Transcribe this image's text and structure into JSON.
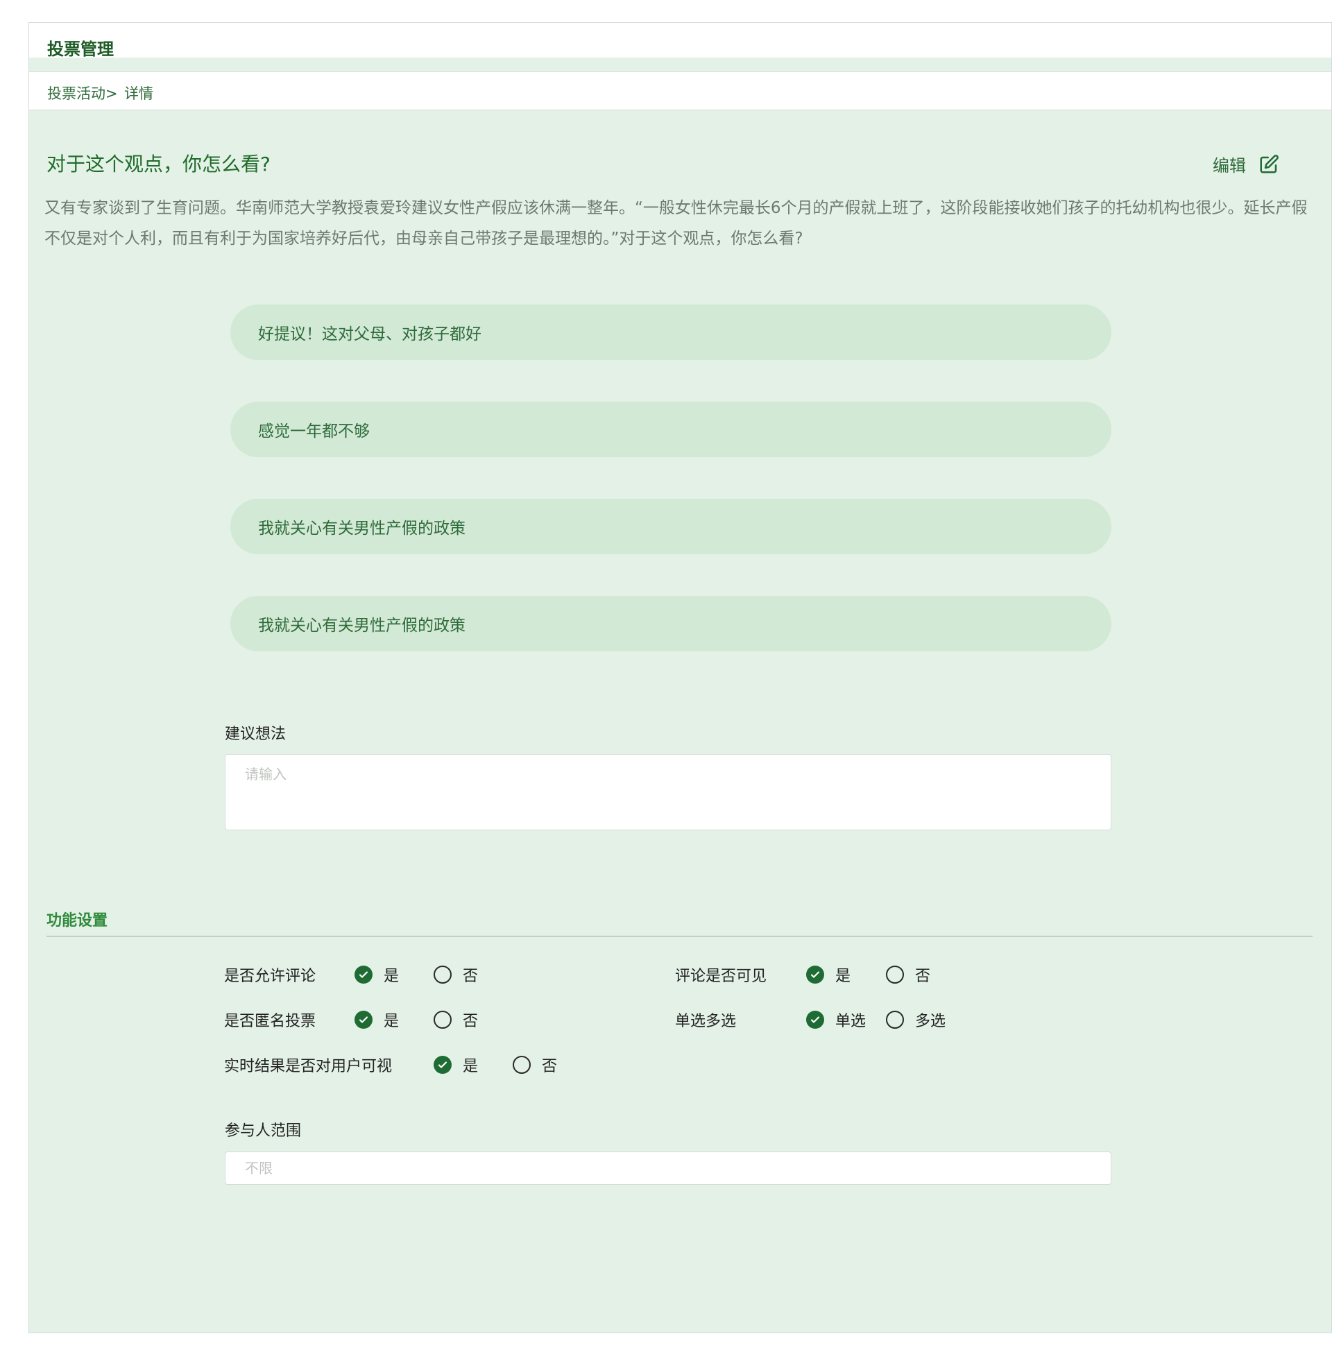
{
  "header": {
    "title": "投票管理"
  },
  "breadcrumb": {
    "parent": "投票活动>",
    "current": "详情"
  },
  "vote": {
    "title": "对于这个观点，你怎么看?",
    "edit_label": "编辑",
    "description": "又有专家谈到了生育问题。华南师范大学教授袁爱玲建议女性产假应该休满一整年。“一般女性休完最长6个月的产假就上班了，这阶段能接收她们孩子的托幼机构也很少。延长产假不仅是对个人利，而且有利于为国家培养好后代，由母亲自己带孩子是最理想的。”对于这个观点，你怎么看?",
    "options": [
      "好提议！这对父母、对孩子都好",
      "感觉一年都不够",
      "我就关心有关男性产假的政策",
      "我就关心有关男性产假的政策"
    ]
  },
  "suggestion": {
    "label": "建议想法",
    "placeholder": "请输入",
    "value": ""
  },
  "settings": {
    "title": "功能设置",
    "allow_comment": {
      "label": "是否允许评论",
      "options": [
        "是",
        "否"
      ],
      "selected": "是"
    },
    "comment_visible": {
      "label": "评论是否可见",
      "options": [
        "是",
        "否"
      ],
      "selected": "是"
    },
    "anonymous": {
      "label": "是否匿名投票",
      "options": [
        "是",
        "否"
      ],
      "selected": "是"
    },
    "single_multi": {
      "label": "单选多选",
      "options": [
        "单选",
        "多选"
      ],
      "selected": "单选"
    },
    "realtime_visible": {
      "label": "实时结果是否对用户可视",
      "options": [
        "是",
        "否"
      ],
      "selected": "是"
    }
  },
  "participants": {
    "label": "参与人范围",
    "placeholder": "不限",
    "value": ""
  },
  "colors": {
    "accent": "#1e6b34",
    "background": "#e4f1e7",
    "option_bg": "#d2e9d6"
  }
}
